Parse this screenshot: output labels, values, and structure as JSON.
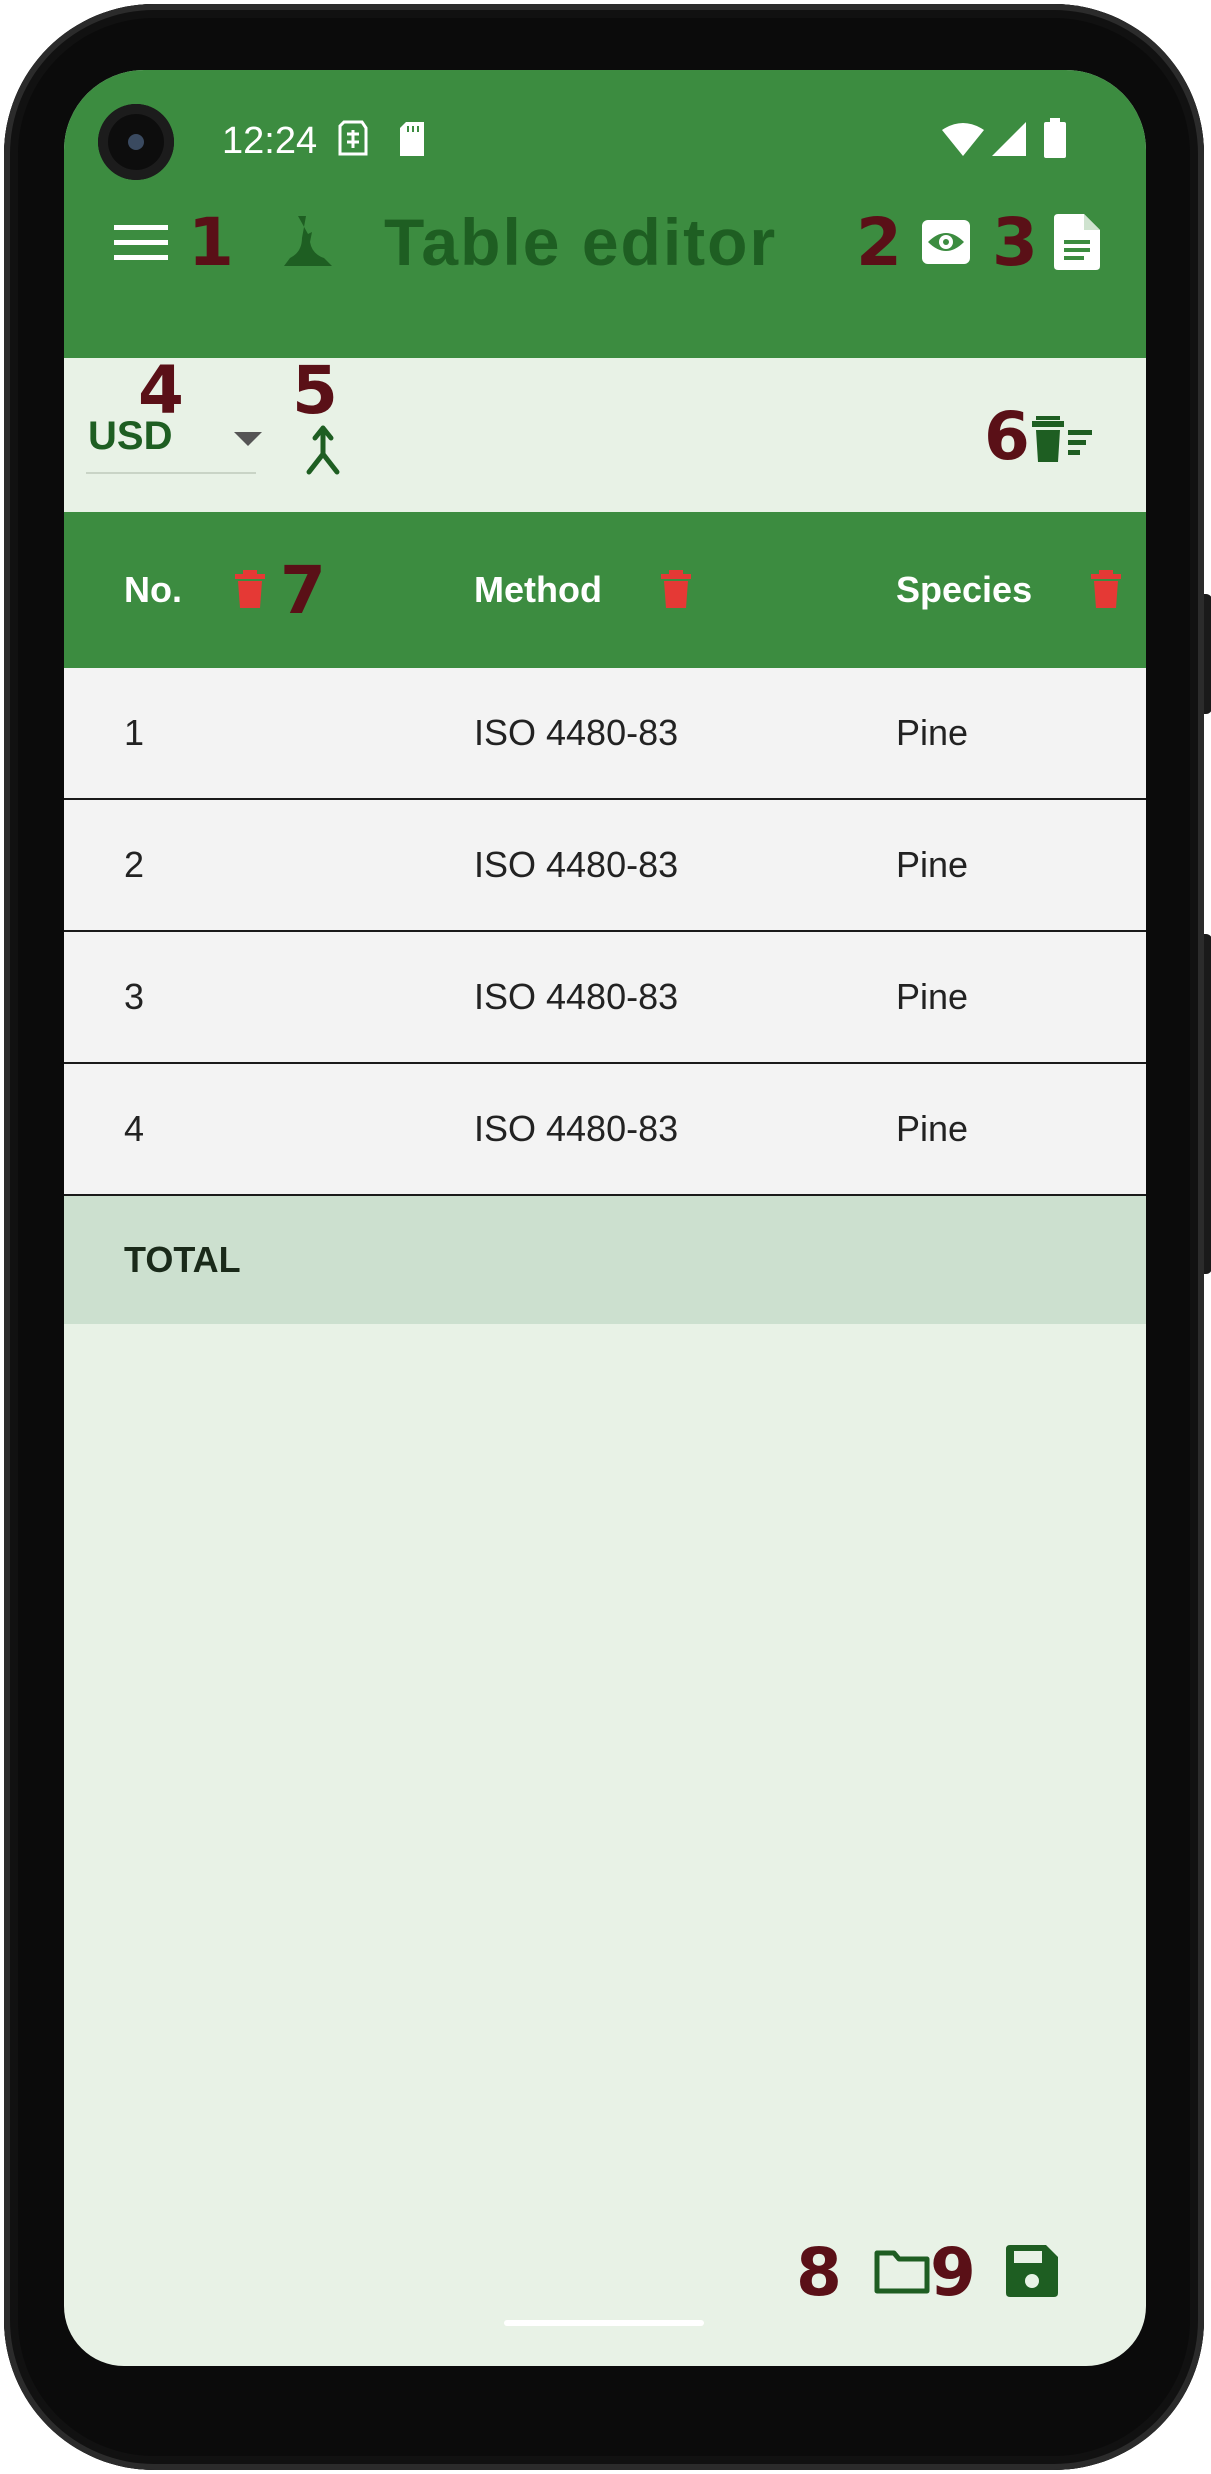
{
  "status_bar": {
    "time": "12:24",
    "icons": [
      "sim-icon",
      "sd-card-icon",
      "wifi-icon",
      "signal-icon",
      "battery-icon"
    ]
  },
  "app_bar": {
    "title": "Table editor",
    "logo_icon": "tree-stump-icon",
    "menu_icon": "hamburger-menu-icon",
    "preview_icon": "eye-icon",
    "document_icon": "document-icon",
    "color_bg": "#3c8c40",
    "color_title": "#1e5e22"
  },
  "annotations": {
    "n1": "1",
    "n2": "2",
    "n3": "3",
    "n4": "4",
    "n5": "5",
    "n6": "6",
    "n7": "7",
    "n8": "8",
    "n9": "9",
    "color": "#5a1017"
  },
  "toolbar": {
    "currency": "USD",
    "merge_icon": "merge-icon",
    "clear_all_icon": "delete-sweep-icon"
  },
  "table": {
    "columns": [
      {
        "label": "No.",
        "delete_icon": "trash-icon"
      },
      {
        "label": "Method",
        "delete_icon": "trash-icon"
      },
      {
        "label": "Species",
        "delete_icon": "trash-icon"
      }
    ],
    "rows": [
      {
        "no": "1",
        "method": "ISO 4480-83",
        "species": "Pine"
      },
      {
        "no": "2",
        "method": "ISO 4480-83",
        "species": "Pine"
      },
      {
        "no": "3",
        "method": "ISO 4480-83",
        "species": "Pine"
      },
      {
        "no": "4",
        "method": "ISO 4480-83",
        "species": "Pine"
      }
    ],
    "total_label": "TOTAL",
    "delete_color": "#e53935"
  },
  "footer": {
    "open_icon": "folder-icon",
    "save_icon": "save-icon"
  }
}
